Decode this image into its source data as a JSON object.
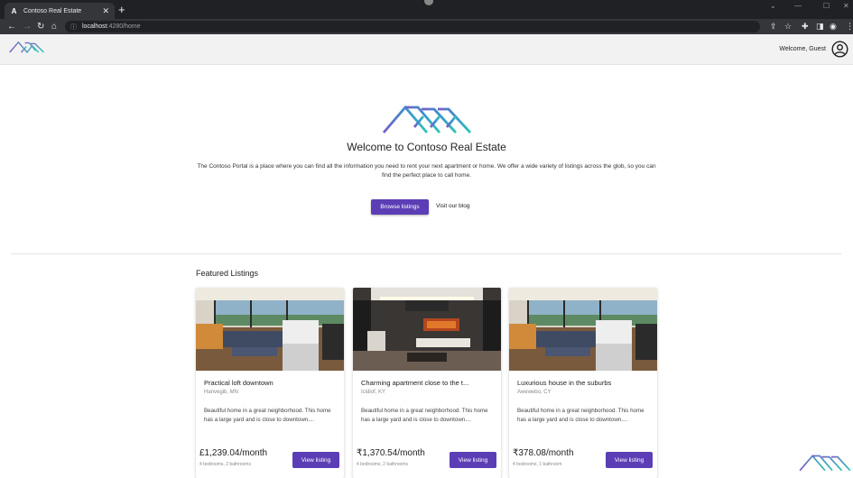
{
  "browser": {
    "tab_title": "Contoso Real Estate",
    "tab_favicon": "A",
    "url_host": "localhost",
    "url_path": ":4280/home"
  },
  "header": {
    "welcome_text": "Welcome, Guest",
    "logo_icon": "mountains-logo",
    "account_icon": "account-circle-icon"
  },
  "hero": {
    "title": "Welcome to Contoso Real Estate",
    "description": "The Contoso Portal is a place where you can find all the information you need to rent your next apartment or home. We offer a wide variety of listings across the glob, so you can find the perfect place to call home.",
    "browse_label": "Browse listings",
    "blog_label": "Visit our blog"
  },
  "featured": {
    "title": "Featured Listings",
    "listings": [
      {
        "title": "Practical loft downtown",
        "location": "Hanvegib, MN",
        "description": "Beautiful home in a great neighborhood. This home has a large yard and is close to downtown....",
        "price": "£1,239.04/month",
        "meta": "4 bedrooms, 2 bathrooms",
        "button": "View listing"
      },
      {
        "title": "Charming apartment close to the t...",
        "location": "Icidiof, KY",
        "description": "Beautiful home in a great neighborhood. This home has a large yard and is close to downtown....",
        "price": "₹1,370.54/month",
        "meta": "4 bedrooms, 2 bathrooms",
        "button": "View listing"
      },
      {
        "title": "Luxurious house in the suburbs",
        "location": "Awewebo, CY",
        "description": "Beautiful home in a great neighborhood. This home has a large yard and is close to downtown....",
        "price": "₹378.08/month",
        "meta": "4 bedrooms, 1 bathroom",
        "button": "View listing"
      }
    ]
  },
  "colors": {
    "primary": "#5b3eb5",
    "logo_teal": "#2ec4b6",
    "logo_purple": "#7a5cc7"
  }
}
